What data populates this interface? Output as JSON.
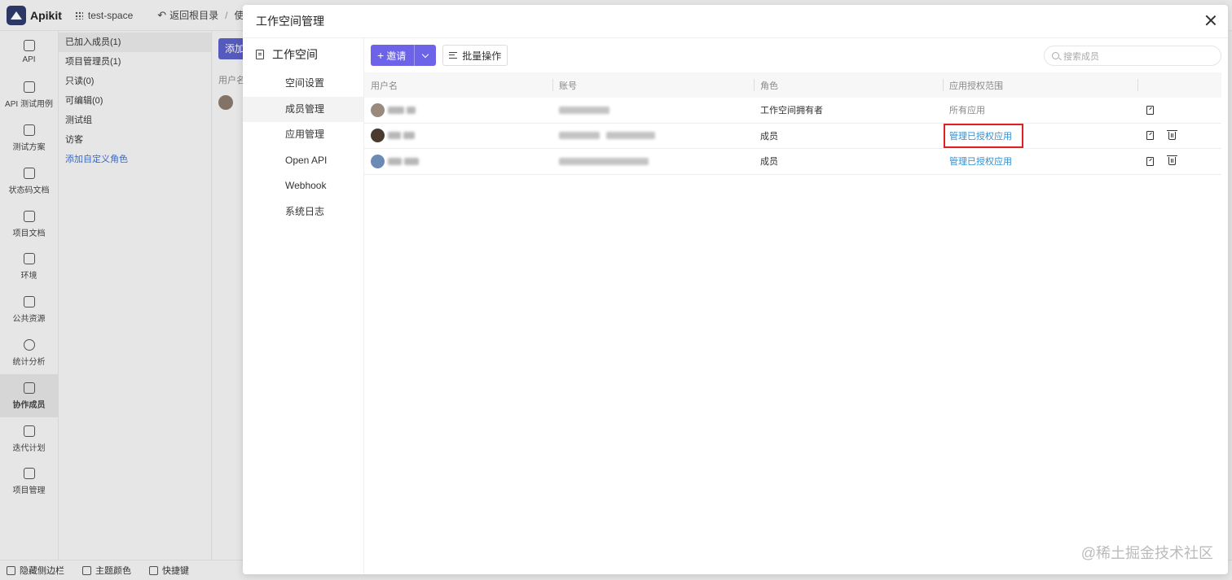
{
  "app": {
    "name": "Apikit",
    "workspace": "test-space",
    "back_label": "返回根目录",
    "breadcrumb_tail": "使用"
  },
  "left_nav": [
    {
      "label": "API",
      "icon": "api-icon"
    },
    {
      "label": "API 测试用例",
      "icon": "test-case-icon"
    },
    {
      "label": "测试方案",
      "icon": "test-plan-icon"
    },
    {
      "label": "状态码文档",
      "icon": "status-doc-icon"
    },
    {
      "label": "项目文档",
      "icon": "project-doc-icon"
    },
    {
      "label": "环境",
      "icon": "environment-icon"
    },
    {
      "label": "公共资源",
      "icon": "puzzle-icon"
    },
    {
      "label": "统计分析",
      "icon": "pie-chart-icon"
    },
    {
      "label": "协作成员",
      "icon": "users-icon",
      "active": true
    },
    {
      "label": "迭代计划",
      "icon": "calendar-icon"
    },
    {
      "label": "项目管理",
      "icon": "gear-icon"
    }
  ],
  "sub_nav": [
    {
      "label": "已加入成员(1)",
      "active": true
    },
    {
      "label": "项目管理员(1)"
    },
    {
      "label": "只读(0)"
    },
    {
      "label": "可编辑(0)"
    },
    {
      "label": "测试组"
    },
    {
      "label": "访客"
    },
    {
      "label": "添加自定义角色",
      "link": true
    }
  ],
  "bg_main": {
    "add_button": "添加",
    "user_header": "用户名"
  },
  "bottom_bar": [
    {
      "label": "隐藏侧边栏"
    },
    {
      "label": "主题颜色"
    },
    {
      "label": "快捷键"
    }
  ],
  "modal": {
    "title": "工作空间管理",
    "side_title": "工作空间",
    "side_items": [
      "空间设置",
      "成员管理",
      "应用管理",
      "Open API",
      "Webhook",
      "系统日志"
    ],
    "active_side_item": "成员管理",
    "invite_label": "邀请",
    "batch_label": "批量操作",
    "search_placeholder": "搜索成员",
    "columns": [
      "用户名",
      "账号",
      "角色",
      "应用授权范围",
      ""
    ],
    "rows": [
      {
        "role": "工作空间拥有者",
        "scope": "所有应用",
        "scope_type": "text",
        "deletable": false,
        "avatar_color": "#9a8a7e"
      },
      {
        "role": "成员",
        "scope": "管理已授权应用",
        "scope_type": "link",
        "deletable": true,
        "highlighted": true,
        "avatar_color": "#4a3b2e"
      },
      {
        "role": "成员",
        "scope": "管理已授权应用",
        "scope_type": "link",
        "deletable": true,
        "avatar_color": "#6b8bb5"
      }
    ]
  },
  "watermark": "@稀土掘金技术社区",
  "colors": {
    "accent": "#6c63e8",
    "link": "#2d8fd5",
    "highlight": "#e02020"
  }
}
